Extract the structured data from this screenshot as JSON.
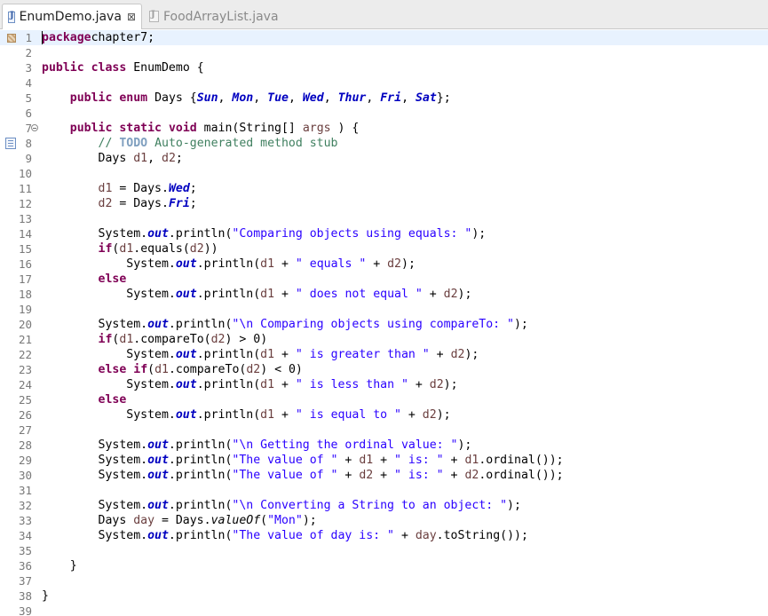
{
  "tabs": [
    {
      "label": "EnumDemo.java",
      "active": true
    },
    {
      "label": "FoodArrayList.java",
      "active": false
    }
  ],
  "icons": {
    "java_file": "java-file-icon",
    "close": "close-icon",
    "task_marker": "task-marker-icon",
    "todo_marker": "todo-marker-icon",
    "fold": "fold-collapse-icon"
  },
  "colors": {
    "keyword": "#7f0055",
    "enum_constant": "#0000c0",
    "string": "#2a00ff",
    "comment": "#3f7f5f",
    "todo": "#7f9fbf",
    "local_variable": "#6a3e3e",
    "current_line": "#e8f2fe"
  },
  "current_line": 1,
  "lines": [
    {
      "n": 1,
      "tokens": [
        [
          "kw",
          "package"
        ],
        [
          "",
          "chapter7;"
        ]
      ]
    },
    {
      "n": 2,
      "tokens": []
    },
    {
      "n": 3,
      "tokens": [
        [
          "kw",
          "public"
        ],
        [
          "",
          " "
        ],
        [
          "kw",
          "class"
        ],
        [
          "",
          " EnumDemo {"
        ]
      ]
    },
    {
      "n": 4,
      "tokens": []
    },
    {
      "n": 5,
      "tokens": [
        [
          "",
          "    "
        ],
        [
          "kw",
          "public"
        ],
        [
          "",
          " "
        ],
        [
          "kw",
          "enum"
        ],
        [
          "",
          " Days {"
        ],
        [
          "ec",
          "Sun"
        ],
        [
          "",
          ", "
        ],
        [
          "ec",
          "Mon"
        ],
        [
          "",
          ", "
        ],
        [
          "ec",
          "Tue"
        ],
        [
          "",
          ", "
        ],
        [
          "ec",
          "Wed"
        ],
        [
          "",
          ", "
        ],
        [
          "ec",
          "Thur"
        ],
        [
          "",
          ", "
        ],
        [
          "ec",
          "Fri"
        ],
        [
          "",
          ", "
        ],
        [
          "ec",
          "Sat"
        ],
        [
          "",
          "};"
        ]
      ]
    },
    {
      "n": 6,
      "tokens": []
    },
    {
      "n": 7,
      "tokens": [
        [
          "",
          "    "
        ],
        [
          "kw",
          "public"
        ],
        [
          "",
          " "
        ],
        [
          "kw",
          "static"
        ],
        [
          "",
          " "
        ],
        [
          "kw",
          "void"
        ],
        [
          "",
          " main(String[] "
        ],
        [
          "var",
          "args"
        ],
        [
          "",
          " ) {"
        ]
      ]
    },
    {
      "n": 8,
      "tokens": [
        [
          "",
          "        "
        ],
        [
          "cm",
          "// "
        ],
        [
          "todo",
          "TODO"
        ],
        [
          "cm",
          " Auto-generated method stub"
        ]
      ]
    },
    {
      "n": 9,
      "tokens": [
        [
          "",
          "        Days "
        ],
        [
          "var",
          "d1"
        ],
        [
          "",
          ", "
        ],
        [
          "var",
          "d2"
        ],
        [
          "",
          ";"
        ]
      ]
    },
    {
      "n": 10,
      "tokens": []
    },
    {
      "n": 11,
      "tokens": [
        [
          "",
          "        "
        ],
        [
          "var",
          "d1"
        ],
        [
          "",
          " = Days."
        ],
        [
          "fld",
          "Wed"
        ],
        [
          "",
          ";"
        ]
      ]
    },
    {
      "n": 12,
      "tokens": [
        [
          "",
          "        "
        ],
        [
          "var",
          "d2"
        ],
        [
          "",
          " = Days."
        ],
        [
          "fld",
          "Fri"
        ],
        [
          "",
          ";"
        ]
      ]
    },
    {
      "n": 13,
      "tokens": []
    },
    {
      "n": 14,
      "tokens": [
        [
          "",
          "        System."
        ],
        [
          "fld",
          "out"
        ],
        [
          "",
          ".println("
        ],
        [
          "st",
          "\"Comparing objects using equals: \""
        ],
        [
          "",
          ");"
        ]
      ]
    },
    {
      "n": 15,
      "tokens": [
        [
          "",
          "        "
        ],
        [
          "kw",
          "if"
        ],
        [
          "",
          "("
        ],
        [
          "var",
          "d1"
        ],
        [
          "",
          ".equals("
        ],
        [
          "var",
          "d2"
        ],
        [
          "",
          "))"
        ]
      ]
    },
    {
      "n": 16,
      "tokens": [
        [
          "",
          "            System."
        ],
        [
          "fld",
          "out"
        ],
        [
          "",
          ".println("
        ],
        [
          "var",
          "d1"
        ],
        [
          "",
          " + "
        ],
        [
          "st",
          "\" equals \""
        ],
        [
          "",
          " + "
        ],
        [
          "var",
          "d2"
        ],
        [
          "",
          ");"
        ]
      ]
    },
    {
      "n": 17,
      "tokens": [
        [
          "",
          "        "
        ],
        [
          "kw",
          "else"
        ]
      ]
    },
    {
      "n": 18,
      "tokens": [
        [
          "",
          "            System."
        ],
        [
          "fld",
          "out"
        ],
        [
          "",
          ".println("
        ],
        [
          "var",
          "d1"
        ],
        [
          "",
          " + "
        ],
        [
          "st",
          "\" does not equal \""
        ],
        [
          "",
          " + "
        ],
        [
          "var",
          "d2"
        ],
        [
          "",
          ");"
        ]
      ]
    },
    {
      "n": 19,
      "tokens": []
    },
    {
      "n": 20,
      "tokens": [
        [
          "",
          "        System."
        ],
        [
          "fld",
          "out"
        ],
        [
          "",
          ".println("
        ],
        [
          "st",
          "\"\\n Comparing objects using compareTo: \""
        ],
        [
          "",
          ");"
        ]
      ]
    },
    {
      "n": 21,
      "tokens": [
        [
          "",
          "        "
        ],
        [
          "kw",
          "if"
        ],
        [
          "",
          "("
        ],
        [
          "var",
          "d1"
        ],
        [
          "",
          ".compareTo("
        ],
        [
          "var",
          "d2"
        ],
        [
          "",
          ") > 0)"
        ]
      ]
    },
    {
      "n": 22,
      "tokens": [
        [
          "",
          "            System."
        ],
        [
          "fld",
          "out"
        ],
        [
          "",
          ".println("
        ],
        [
          "var",
          "d1"
        ],
        [
          "",
          " + "
        ],
        [
          "st",
          "\" is greater than \""
        ],
        [
          "",
          " + "
        ],
        [
          "var",
          "d2"
        ],
        [
          "",
          ");"
        ]
      ]
    },
    {
      "n": 23,
      "tokens": [
        [
          "",
          "        "
        ],
        [
          "kw",
          "else"
        ],
        [
          "",
          " "
        ],
        [
          "kw",
          "if"
        ],
        [
          "",
          "("
        ],
        [
          "var",
          "d1"
        ],
        [
          "",
          ".compareTo("
        ],
        [
          "var",
          "d2"
        ],
        [
          "",
          ") < 0)"
        ]
      ]
    },
    {
      "n": 24,
      "tokens": [
        [
          "",
          "            System."
        ],
        [
          "fld",
          "out"
        ],
        [
          "",
          ".println("
        ],
        [
          "var",
          "d1"
        ],
        [
          "",
          " + "
        ],
        [
          "st",
          "\" is less than \""
        ],
        [
          "",
          " + "
        ],
        [
          "var",
          "d2"
        ],
        [
          "",
          ");"
        ]
      ]
    },
    {
      "n": 25,
      "tokens": [
        [
          "",
          "        "
        ],
        [
          "kw",
          "else"
        ]
      ]
    },
    {
      "n": 26,
      "tokens": [
        [
          "",
          "            System."
        ],
        [
          "fld",
          "out"
        ],
        [
          "",
          ".println("
        ],
        [
          "var",
          "d1"
        ],
        [
          "",
          " + "
        ],
        [
          "st",
          "\" is equal to \""
        ],
        [
          "",
          " + "
        ],
        [
          "var",
          "d2"
        ],
        [
          "",
          ");"
        ]
      ]
    },
    {
      "n": 27,
      "tokens": []
    },
    {
      "n": 28,
      "tokens": [
        [
          "",
          "        System."
        ],
        [
          "fld",
          "out"
        ],
        [
          "",
          ".println("
        ],
        [
          "st",
          "\"\\n Getting the ordinal value: \""
        ],
        [
          "",
          ");"
        ]
      ]
    },
    {
      "n": 29,
      "tokens": [
        [
          "",
          "        System."
        ],
        [
          "fld",
          "out"
        ],
        [
          "",
          ".println("
        ],
        [
          "st",
          "\"The value of \""
        ],
        [
          "",
          " + "
        ],
        [
          "var",
          "d1"
        ],
        [
          "",
          " + "
        ],
        [
          "st",
          "\" is: \""
        ],
        [
          "",
          " + "
        ],
        [
          "var",
          "d1"
        ],
        [
          "",
          ".ordinal());"
        ]
      ]
    },
    {
      "n": 30,
      "tokens": [
        [
          "",
          "        System."
        ],
        [
          "fld",
          "out"
        ],
        [
          "",
          ".println("
        ],
        [
          "st",
          "\"The value of \""
        ],
        [
          "",
          " + "
        ],
        [
          "var",
          "d2"
        ],
        [
          "",
          " + "
        ],
        [
          "st",
          "\" is: \""
        ],
        [
          "",
          " + "
        ],
        [
          "var",
          "d2"
        ],
        [
          "",
          ".ordinal());"
        ]
      ]
    },
    {
      "n": 31,
      "tokens": []
    },
    {
      "n": 32,
      "tokens": [
        [
          "",
          "        System."
        ],
        [
          "fld",
          "out"
        ],
        [
          "",
          ".println("
        ],
        [
          "st",
          "\"\\n Converting a String to an object: \""
        ],
        [
          "",
          ");"
        ]
      ]
    },
    {
      "n": 33,
      "tokens": [
        [
          "",
          "        Days "
        ],
        [
          "var",
          "day"
        ],
        [
          "",
          " = Days."
        ],
        [
          "sm",
          "valueOf"
        ],
        [
          "",
          "("
        ],
        [
          "st",
          "\"Mon\""
        ],
        [
          "",
          ");"
        ]
      ]
    },
    {
      "n": 34,
      "tokens": [
        [
          "",
          "        System."
        ],
        [
          "fld",
          "out"
        ],
        [
          "",
          ".println("
        ],
        [
          "st",
          "\"The value of day is: \""
        ],
        [
          "",
          " + "
        ],
        [
          "var",
          "day"
        ],
        [
          "",
          ".toString());"
        ]
      ]
    },
    {
      "n": 35,
      "tokens": []
    },
    {
      "n": 36,
      "tokens": [
        [
          "",
          "    }"
        ]
      ]
    },
    {
      "n": 37,
      "tokens": []
    },
    {
      "n": 38,
      "tokens": [
        [
          "",
          "}"
        ]
      ]
    },
    {
      "n": 39,
      "tokens": []
    }
  ]
}
